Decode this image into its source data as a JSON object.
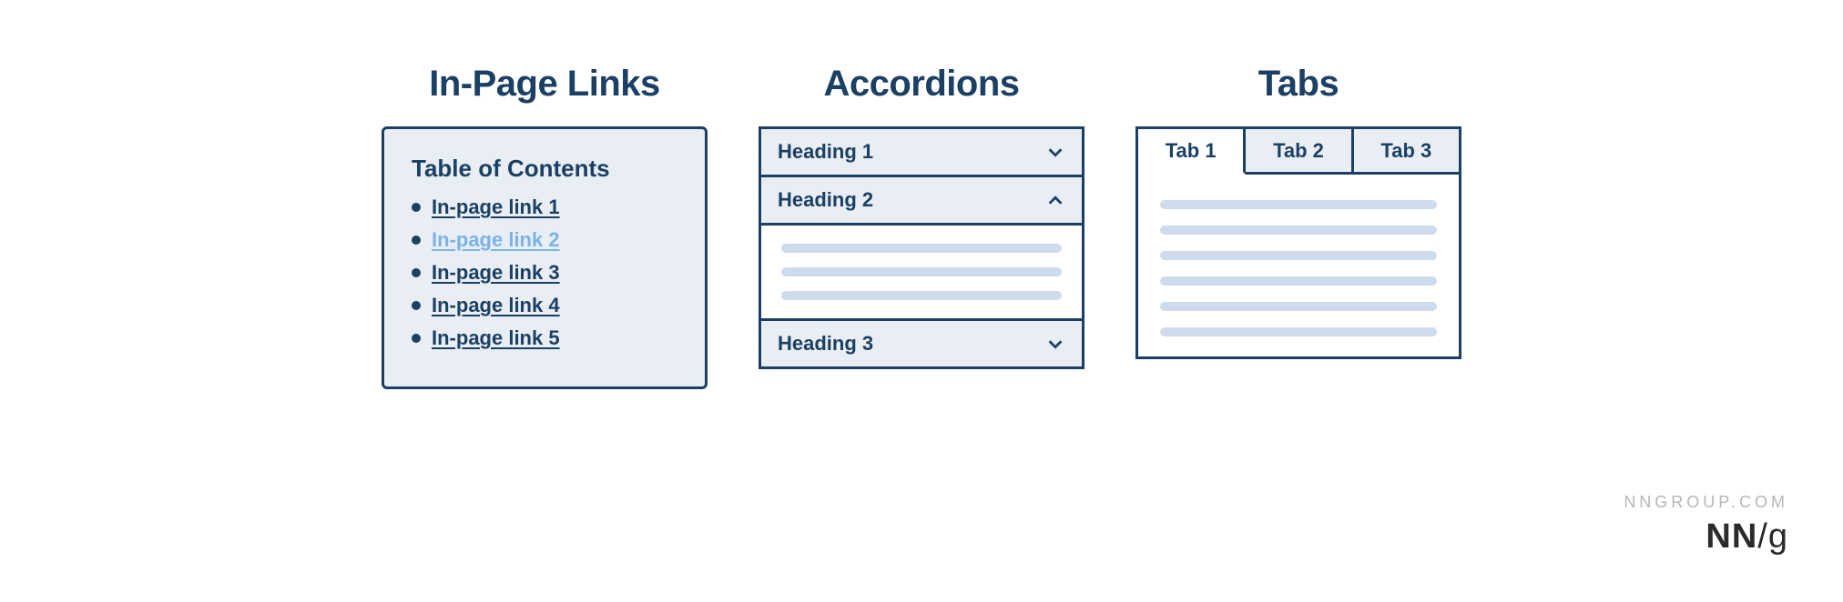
{
  "panels": {
    "inpage": {
      "title": "In-Page Links",
      "toc_heading": "Table of Contents",
      "links": [
        {
          "label": "In-page link 1",
          "active": false
        },
        {
          "label": "In-page link 2",
          "active": true
        },
        {
          "label": "In-page link 3",
          "active": false
        },
        {
          "label": "In-page link 4",
          "active": false
        },
        {
          "label": "In-page link 5",
          "active": false
        }
      ]
    },
    "accordions": {
      "title": "Accordions",
      "items": [
        {
          "label": "Heading 1",
          "expanded": false
        },
        {
          "label": "Heading 2",
          "expanded": true
        },
        {
          "label": "Heading 3",
          "expanded": false
        }
      ]
    },
    "tabs": {
      "title": "Tabs",
      "items": [
        {
          "label": "Tab 1",
          "active": true
        },
        {
          "label": "Tab 2",
          "active": false
        },
        {
          "label": "Tab 3",
          "active": false
        }
      ]
    }
  },
  "attribution": {
    "url": "NNGROUP.COM",
    "logo_nn": "NN",
    "logo_slash": "/",
    "logo_g": "g"
  },
  "colors": {
    "primary": "#1b4063",
    "panel_bg": "#e9eef5",
    "line_fill": "#cddbec",
    "active_link": "#7bb3e7"
  }
}
